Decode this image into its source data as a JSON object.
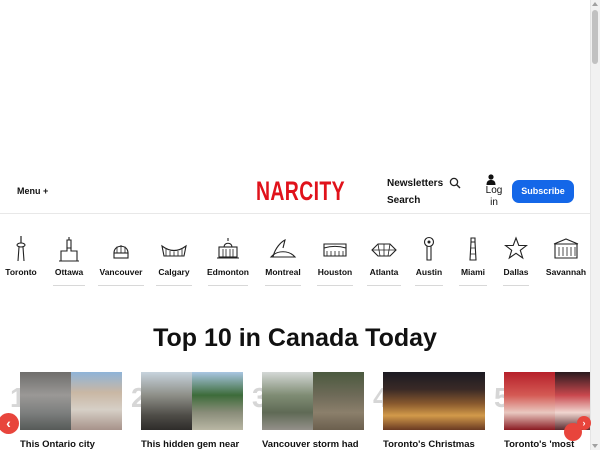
{
  "header": {
    "menu_label": "Menu +",
    "logo_text": "NARCITY",
    "newsletters_label": "Newsletters",
    "search_label": "Search",
    "login_label": "Log in",
    "subscribe_label": "Subscribe"
  },
  "colors": {
    "brand_red": "#e0121b",
    "subscribe_blue": "#1467e8",
    "arrow_red": "#e8453c"
  },
  "cities": [
    {
      "name": "Toronto",
      "icon": "cn-tower-icon"
    },
    {
      "name": "Ottawa",
      "icon": "parliament-icon"
    },
    {
      "name": "Vancouver",
      "icon": "dome-icon"
    },
    {
      "name": "Calgary",
      "icon": "saddledome-icon"
    },
    {
      "name": "Edmonton",
      "icon": "legislature-icon"
    },
    {
      "name": "Montreal",
      "icon": "olympic-stadium-icon"
    },
    {
      "name": "Houston",
      "icon": "stadium-icon"
    },
    {
      "name": "Atlanta",
      "icon": "arena-icon"
    },
    {
      "name": "Austin",
      "icon": "tower-icon"
    },
    {
      "name": "Miami",
      "icon": "lighthouse-icon"
    },
    {
      "name": "Dallas",
      "icon": "star-icon"
    },
    {
      "name": "Savannah",
      "icon": "building-icon"
    }
  ],
  "top10": {
    "title": "Top 10 in Canada Today",
    "items": [
      {
        "rank": "1",
        "title": "This Ontario city"
      },
      {
        "rank": "2",
        "title": "This hidden gem near"
      },
      {
        "rank": "3",
        "title": "Vancouver storm had"
      },
      {
        "rank": "4",
        "title": "Toronto's Christmas"
      },
      {
        "rank": "5",
        "title": "Toronto's 'most"
      }
    ]
  }
}
